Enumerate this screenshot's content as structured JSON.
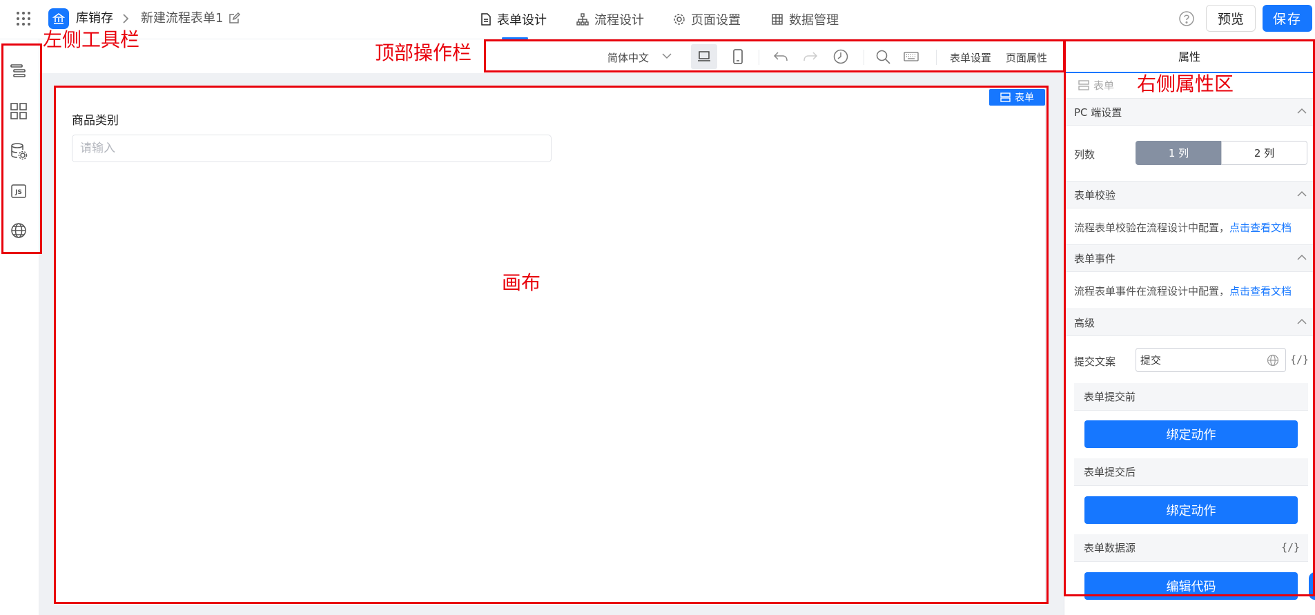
{
  "header": {
    "app_name": "库销存",
    "form_name": "新建流程表单1",
    "tabs": [
      {
        "label": "表单设计",
        "icon": "document-icon",
        "active": true
      },
      {
        "label": "流程设计",
        "icon": "flow-icon",
        "active": false
      },
      {
        "label": "页面设置",
        "icon": "gear-icon",
        "active": false
      },
      {
        "label": "数据管理",
        "icon": "table-icon",
        "active": false
      }
    ],
    "preview_label": "预览",
    "save_label": "保存",
    "accent": "#1677ff"
  },
  "left_toolbar": {
    "icons": [
      "outline-tree-icon",
      "components-grid-icon",
      "datasource-icon",
      "js-icon",
      "globe-icon"
    ]
  },
  "action_bar": {
    "language": "简体中文",
    "form_settings": "表单设置",
    "page_props": "页面属性"
  },
  "canvas": {
    "form_tag": "表单",
    "field_label": "商品类别",
    "field_placeholder": "请输入"
  },
  "right_panel": {
    "tab": "属性",
    "crumb": "表单",
    "pc_section": "PC 端设置",
    "columns_label": "列数",
    "col_options": [
      "1 列",
      "2 列"
    ],
    "validation_section": "表单校验",
    "validation_text": "流程表单校验在流程设计中配置，",
    "doc_link": "点击查看文档",
    "events_section": "表单事件",
    "events_text": "流程表单事件在流程设计中配置，",
    "advanced_section": "高级",
    "submit_label": "提交文案",
    "submit_value": "提交",
    "before_submit": "表单提交前",
    "after_submit": "表单提交后",
    "bind_action": "绑定动作",
    "datasource": "表单数据源",
    "edit_code": "编辑代码",
    "code_symbol": "{/}"
  },
  "annotations": {
    "left_toolbar": "左侧工具栏",
    "top_bar": "顶部操作栏",
    "right_panel": "右侧属性区",
    "canvas": "画布",
    "color": "#e8000b"
  }
}
